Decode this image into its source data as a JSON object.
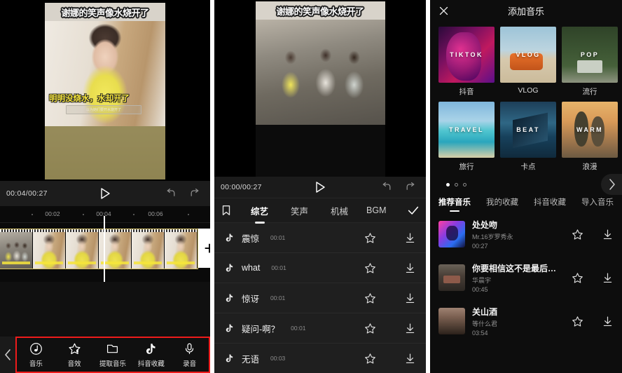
{
  "editor": {
    "video_title_overlay": "谢娜的笑声像水烧开了",
    "video_subtitle": "明明没烧水，水却开了",
    "subtitle_box_text": "以为她们要开水烧开了",
    "time_code": "00:04/00:27",
    "ruler_ticks": [
      "00:02",
      "00:04",
      "00:06"
    ],
    "play_icon": "play-icon",
    "undo_icon": "undo-icon",
    "redo_icon": "redo-icon",
    "add_clip_label": "+",
    "back_icon": "chevron-left-icon",
    "highlight_color": "#ee1b1b",
    "toolbar": [
      {
        "label": "音乐",
        "icon": "music-note-circle-icon"
      },
      {
        "label": "音效",
        "icon": "star-sound-icon"
      },
      {
        "label": "提取音乐",
        "icon": "folder-icon"
      },
      {
        "label": "抖音收藏",
        "icon": "tiktok-note-icon"
      },
      {
        "label": "录音",
        "icon": "microphone-icon"
      }
    ]
  },
  "sfx_panel": {
    "video_title_overlay": "谢娜的笑声像水烧开了",
    "time_code": "00:00/00:27",
    "play_icon": "play-icon",
    "undo_icon": "undo-icon",
    "redo_icon": "redo-icon",
    "bookmark_icon": "bookmark-icon",
    "confirm_icon": "check-icon",
    "categories": [
      {
        "label": "综艺",
        "active": true
      },
      {
        "label": "笑声",
        "active": false
      },
      {
        "label": "机械",
        "active": false
      },
      {
        "label": "BGM",
        "active": false
      }
    ],
    "sounds": [
      {
        "name": "震惊",
        "duration": "00:01"
      },
      {
        "name": "what",
        "duration": "00:01"
      },
      {
        "name": "惊讶",
        "duration": "00:01"
      },
      {
        "name": "疑问-啊？",
        "duration": "00:01"
      },
      {
        "name": "无语",
        "duration": "00:03"
      }
    ],
    "favorite_icon": "star-icon",
    "download_icon": "download-icon"
  },
  "music_panel": {
    "title": "添加音乐",
    "close_icon": "close-icon",
    "next_icon": "chevron-right-icon",
    "categories": [
      {
        "label": "抖音",
        "art_text": "TIKTOK",
        "art": "art-tiktok"
      },
      {
        "label": "VLOG",
        "art_text": "VLOG",
        "art": "art-vlog"
      },
      {
        "label": "流行",
        "art_text": "POP",
        "art": "art-pop"
      },
      {
        "label": "旅行",
        "art_text": "TRAVEL",
        "art": "art-travel"
      },
      {
        "label": "卡点",
        "art_text": "BEAT",
        "art": "art-beat"
      },
      {
        "label": "浪漫",
        "art_text": "WARM",
        "art": "art-warm"
      }
    ],
    "pagination": {
      "total": 3,
      "active": 1
    },
    "tabs": [
      {
        "label": "推荐音乐",
        "active": true
      },
      {
        "label": "我的收藏",
        "active": false
      },
      {
        "label": "抖音收藏",
        "active": false
      },
      {
        "label": "导入音乐",
        "active": false
      }
    ],
    "songs": [
      {
        "title": "处处吻",
        "artist": "Mr.16岁罗秀永",
        "duration": "00:27",
        "art": "sa-1"
      },
      {
        "title": "你要相信这不是最后…",
        "artist": "华晨宇",
        "duration": "00:45",
        "art": "sa-2"
      },
      {
        "title": "关山酒",
        "artist": "等什么君",
        "duration": "03:54",
        "art": "sa-3"
      }
    ],
    "favorite_icon": "star-icon",
    "download_icon": "download-icon"
  }
}
